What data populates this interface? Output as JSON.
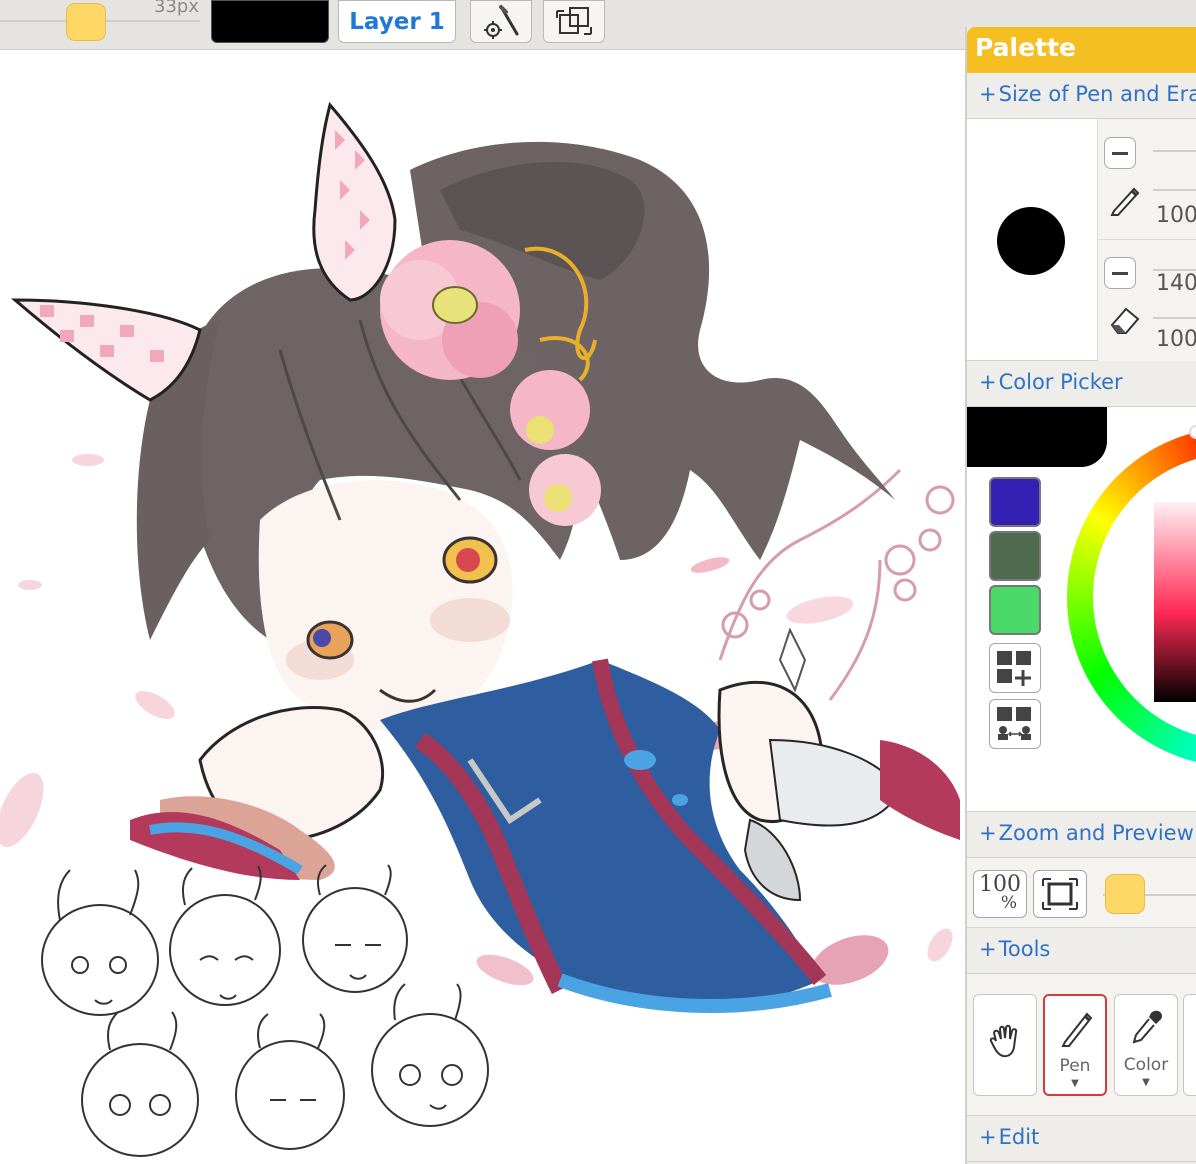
{
  "toolbar": {
    "brush_size": "33px",
    "current_color": "#000000",
    "layer_label": "Layer 1",
    "slider_color": "#ffd766"
  },
  "palette": {
    "title": "Palette",
    "sections": {
      "pen_eraser": "Size of Pen and Eraser",
      "color_picker": "Color Picker",
      "zoom_preview": "Zoom and Preview",
      "tools": "Tools",
      "edit": "Edit"
    },
    "pen": {
      "size_value": "100",
      "opacity_value": "140"
    },
    "eraser": {
      "size_value": "100"
    },
    "color_picker": {
      "current_color": "#000000",
      "swatches": [
        "#3421b4",
        "#4f6b4f",
        "#4bd96a"
      ]
    },
    "zoom": {
      "zoom_value": "100",
      "zoom_unit": "%"
    },
    "tools": [
      {
        "label": ""
      },
      {
        "label": "Pen"
      },
      {
        "label": "Color"
      }
    ]
  }
}
